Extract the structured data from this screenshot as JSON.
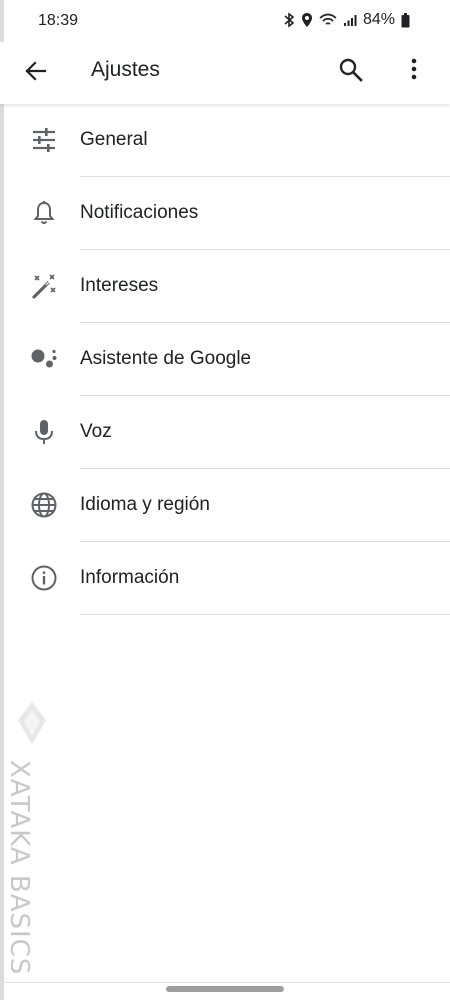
{
  "status_bar": {
    "time": "18:39",
    "battery": "84%"
  },
  "header": {
    "title": "Ajustes"
  },
  "settings": [
    {
      "label": "General",
      "icon": "tune-icon"
    },
    {
      "label": "Notificaciones",
      "icon": "bell-icon"
    },
    {
      "label": "Intereses",
      "icon": "magic-wand-icon"
    },
    {
      "label": "Asistente de Google",
      "icon": "google-assistant-icon"
    },
    {
      "label": "Voz",
      "icon": "microphone-icon"
    },
    {
      "label": "Idioma y región",
      "icon": "globe-icon"
    },
    {
      "label": "Información",
      "icon": "info-icon"
    }
  ],
  "watermark": {
    "text": "XATAKA BASICS"
  },
  "colors": {
    "icon": "#5f6368",
    "text": "#202124",
    "divider": "#dadce0"
  }
}
